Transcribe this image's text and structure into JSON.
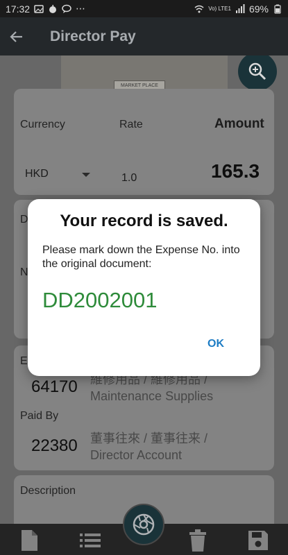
{
  "status_bar": {
    "time": "17:32",
    "network": "Vo) LTE1",
    "battery": "69%"
  },
  "app_bar": {
    "title": "Director Pay"
  },
  "photo": {
    "tag_text": "MARKET PLACE"
  },
  "card1": {
    "currency_label": "Currency",
    "rate_label": "Rate",
    "amount_label": "Amount",
    "currency_value": "HKD",
    "rate_value": "1.0",
    "amount_value": "165.3"
  },
  "card2": {
    "partial_label_1": "D",
    "partial_label_2": "N"
  },
  "card3": {
    "expense_label": "E",
    "expense_code": "64170",
    "expense_desc_line1": "維修用品 / 維修用品 /",
    "expense_desc_line2": "Maintenance Supplies",
    "paid_by_label": "Paid By",
    "paid_by_code": "22380",
    "paid_by_desc_line1": "董事往來 / 董事往来 /",
    "paid_by_desc_line2": "Director Account"
  },
  "card4": {
    "description_label": "Description"
  },
  "dialog": {
    "title": "Your record is saved.",
    "message": "Please mark down the Expense No. into the original document:",
    "expense_no": "DD2002001",
    "ok_label": "OK"
  },
  "colors": {
    "accent_green": "#2e8b3a",
    "ok_blue": "#1d7cc4",
    "app_bar": "#2b2f33",
    "fab": "#1f3c43"
  }
}
